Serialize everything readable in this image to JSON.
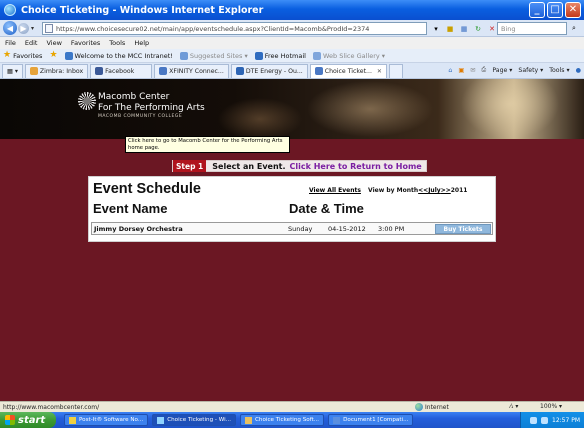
{
  "window": {
    "title": "Choice Ticketing - Windows Internet Explorer",
    "minimize": "_",
    "maximize": "□",
    "close": "✕"
  },
  "address": {
    "url": "https://www.choicesecure02.net/main/app/eventschedule.aspx?ClientId=Macomb&ProdId=2374",
    "search_placeholder": "Bing"
  },
  "menu": [
    "File",
    "Edit",
    "View",
    "Favorites",
    "Tools",
    "Help"
  ],
  "favorites_bar": {
    "label": "Favorites",
    "items": [
      {
        "label": "Welcome to the MCC Intranet!",
        "dim": false
      },
      {
        "label": "Suggested Sites ▾",
        "dim": true
      },
      {
        "label": "Free Hotmail",
        "dim": false
      },
      {
        "label": "Web Slice Gallery ▾",
        "dim": true
      }
    ]
  },
  "tabs": [
    {
      "label": "Zimbra: Inbox"
    },
    {
      "label": "Facebook"
    },
    {
      "label": "XFINITY Connec..."
    },
    {
      "label": "DTE Energy - Ou..."
    },
    {
      "label": "Choice Ticket...",
      "active": true,
      "close": "✕"
    }
  ],
  "command_bar": [
    "Page ▾",
    "Safety ▾",
    "Tools ▾"
  ],
  "page": {
    "logo": {
      "line1": "Macomb Center",
      "line2": "For The Performing Arts",
      "line3": "MACOMB COMMUNITY COLLEGE"
    },
    "tooltip": "Click here to go to Macomb Center for the Performing Arts home page.",
    "step": {
      "badge": "Step 1",
      "text": "Select an Event.",
      "link": "Click Here to Return to Home"
    },
    "schedule": {
      "title": "Event Schedule",
      "view_all": "View All Events",
      "view_by_month": "View by Month",
      "prev": "<<",
      "month": "July",
      "next": ">>",
      "year": "2011",
      "col_name": "Event Name",
      "col_date": "Date & Time",
      "events": [
        {
          "name": "Jimmy Dorsey Orchestra",
          "day": "Sunday",
          "date": "04-15-2012",
          "time": "3:00 PM",
          "action": "Buy Tickets"
        }
      ]
    }
  },
  "status": {
    "url": "http://www.macombcenter.com/",
    "zone": "Internet",
    "misc": "⁄₁ ▾",
    "zoom": "100% ▾"
  },
  "taskbar": {
    "start": "start",
    "items": [
      {
        "label": "Post-It® Software No..."
      },
      {
        "label": "Choice Ticketing - Wi...",
        "active": true
      },
      {
        "label": "Choice Ticketing Soft..."
      },
      {
        "label": "Document1 [Compati..."
      }
    ],
    "clock": "12:57 PM"
  }
}
